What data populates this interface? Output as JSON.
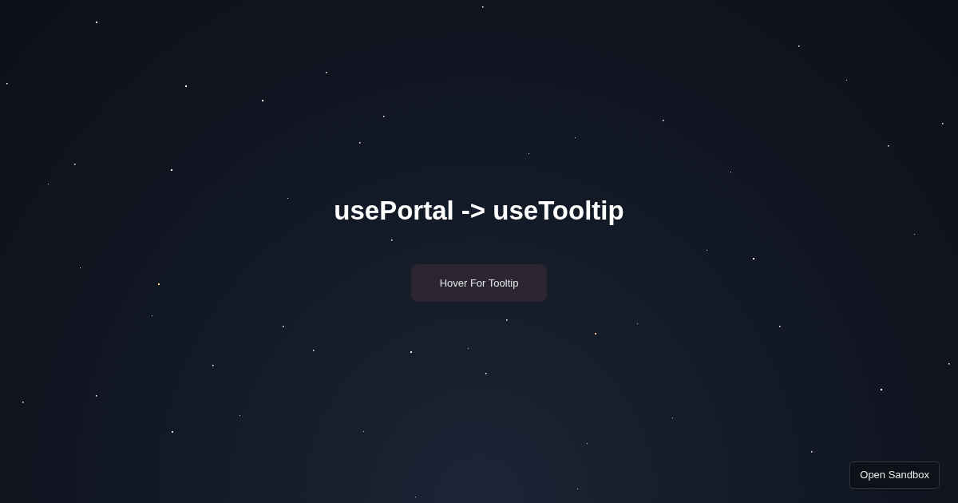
{
  "heading": "usePortal -> useTooltip",
  "hover_button": {
    "label": "Hover For Tooltip"
  },
  "sandbox_button": {
    "label": "Open Sandbox"
  }
}
